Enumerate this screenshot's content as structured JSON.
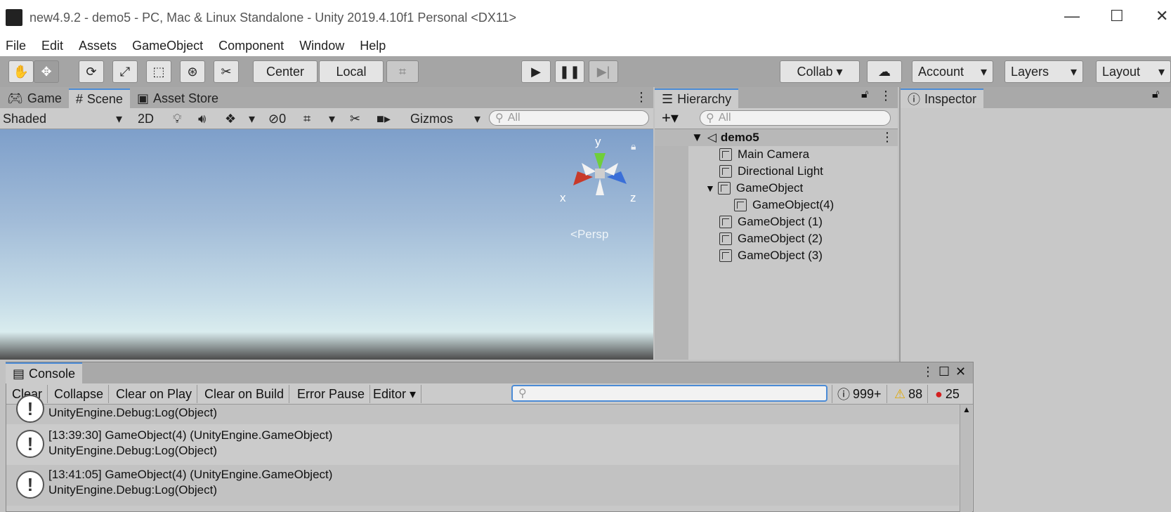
{
  "window": {
    "title": "new4.9.2 - demo5 - PC, Mac & Linux Standalone - Unity 2019.4.10f1 Personal <DX11>",
    "minimize": "—",
    "maximize": "☐",
    "close": "✕"
  },
  "menu": [
    "File",
    "Edit",
    "Assets",
    "GameObject",
    "Component",
    "Window",
    "Help"
  ],
  "toolbar": {
    "center": "Center",
    "local": "Local",
    "collab": "Collab ▾",
    "account": "Account",
    "layers": "Layers",
    "layout": "Layout"
  },
  "scene": {
    "tabs": [
      "Game",
      "Scene",
      "Asset Store"
    ],
    "shading": "Shaded",
    "mode2d": "2D",
    "hidden_count": "0",
    "gizmos": "Gizmos",
    "search_placeholder": "All",
    "persp": "Persp",
    "axis_x": "x",
    "axis_y": "y",
    "axis_z": "z"
  },
  "hierarchy": {
    "tab": "Hierarchy",
    "search_placeholder": "All",
    "scene_name": "demo5",
    "items": [
      {
        "label": "Main Camera"
      },
      {
        "label": "Directional Light"
      },
      {
        "label": "GameObject"
      },
      {
        "label": "GameObject(4)"
      },
      {
        "label": "GameObject (1)"
      },
      {
        "label": "GameObject (2)"
      },
      {
        "label": "GameObject (3)"
      }
    ]
  },
  "inspector": {
    "tab": "Inspector"
  },
  "console": {
    "tab": "Console",
    "buttons": [
      "Clear",
      "Collapse",
      "Clear on Play",
      "Clear on Build",
      "Error Pause",
      "Editor ▾"
    ],
    "counts": {
      "info": "999+",
      "warn": "88",
      "error": "25"
    },
    "logs": [
      {
        "line1": "",
        "line2": "UnityEngine.Debug:Log(Object)"
      },
      {
        "line1": "[13:39:30] GameObject(4) (UnityEngine.GameObject)",
        "line2": "UnityEngine.Debug:Log(Object)"
      },
      {
        "line1": "[13:41:05] GameObject(4) (UnityEngine.GameObject)",
        "line2": "UnityEngine.Debug:Log(Object)"
      }
    ]
  }
}
